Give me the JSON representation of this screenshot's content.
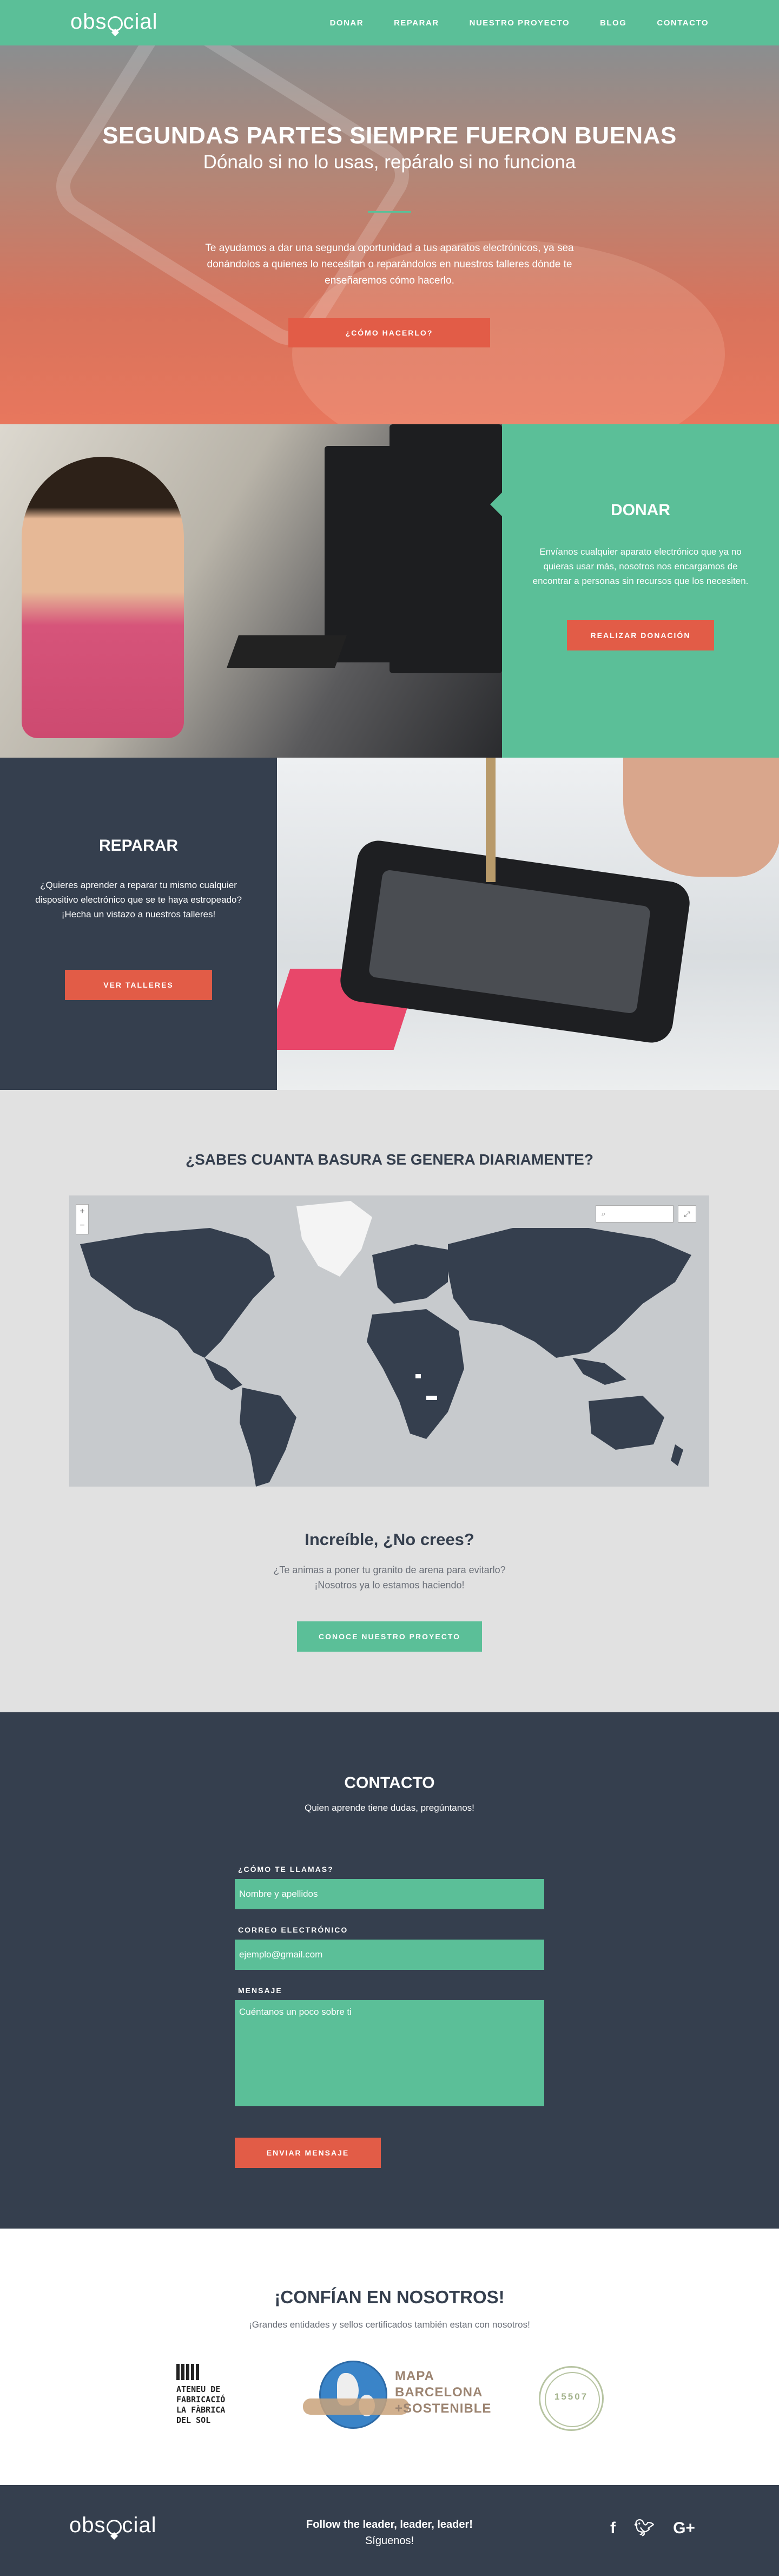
{
  "nav": {
    "logo": "obsocial",
    "items": [
      "DONAR",
      "REPARAR",
      "NUESTRO PROYECTO",
      "BLOG",
      "CONTACTO"
    ]
  },
  "hero": {
    "title": "SEGUNDAS PARTES SIEMPRE FUERON BUENAS",
    "subtitle": "Dónalo si no lo usas, repáralo si no funciona",
    "text": "Te ayudamos a dar una segunda oportunidad a tus aparatos electrónicos, ya sea donándolos a quienes lo necesitan o reparándolos en nuestros talleres dónde te enseñaremos cómo hacerlo.",
    "button": "¿CÓMO HACERLO?"
  },
  "donar": {
    "title": "DONAR",
    "text": "Envíanos cualquier aparato electrónico que ya no quieras usar más, nosotros nos encargamos de encontrar a personas sin recursos que los necesiten.",
    "button": "REALIZAR DONACIÓN"
  },
  "reparar": {
    "title": "REPARAR",
    "text": "¿Quieres aprender a reparar tu mismo cualquier dispositivo electrónico que se te haya estropeado? ¡Hecha un vistazo a nuestros talleres!",
    "button": "VER TALLERES"
  },
  "waste": {
    "title": "¿SABES CUANTA BASURA SE GENERA DIARIAMENTE?",
    "map_controls": {
      "zoom_in": "+",
      "zoom_out": "−",
      "search_icon": "⌕",
      "fullscreen_icon": "⤢"
    },
    "subtitle": "Increíble, ¿No crees?",
    "text_line1": "¿Te animas a poner tu granito de arena para evitarlo?",
    "text_line2": "¡Nosotros ya lo estamos haciendo!",
    "button": "CONOCE NUESTRO PROYECTO"
  },
  "contact": {
    "title": "CONTACTO",
    "subtitle": "Quien aprende tiene dudas, pregúntanos!",
    "name_label": "¿CÓMO TE LLAMAS?",
    "name_placeholder": "Nombre y apellidos",
    "email_label": "CORREO ELECTRÓNICO",
    "email_placeholder": "ejemplo@gmail.com",
    "message_label": "MENSAJE",
    "message_placeholder": "Cuéntanos un poco sobre ti",
    "button": "ENVIAR MENSAJE"
  },
  "trust": {
    "title": "¡CONFÍAN EN NOSOTROS!",
    "subtitle": "¡Grandes entidades y sellos certificados también estan con nosotros!",
    "ateneu_lines": [
      "ATENEU DE",
      "FABRICACIÓ",
      "LA FÀBRICA",
      "DEL SOL"
    ],
    "mapa_lines": [
      "MAPA",
      "BARCELONA",
      "+SOSTENIBLE"
    ],
    "seal_text": "15507"
  },
  "footer": {
    "logo": "obsocial",
    "tag_line1": "Follow the leader, leader, leader!",
    "tag_line2": "Síguenos!",
    "social": [
      "facebook-icon",
      "twitter-icon",
      "google-plus-icon"
    ]
  },
  "colors": {
    "green": "#5bbf98",
    "navy": "#353f4e",
    "red": "#e25c47",
    "grey": "#e1e1e1"
  }
}
